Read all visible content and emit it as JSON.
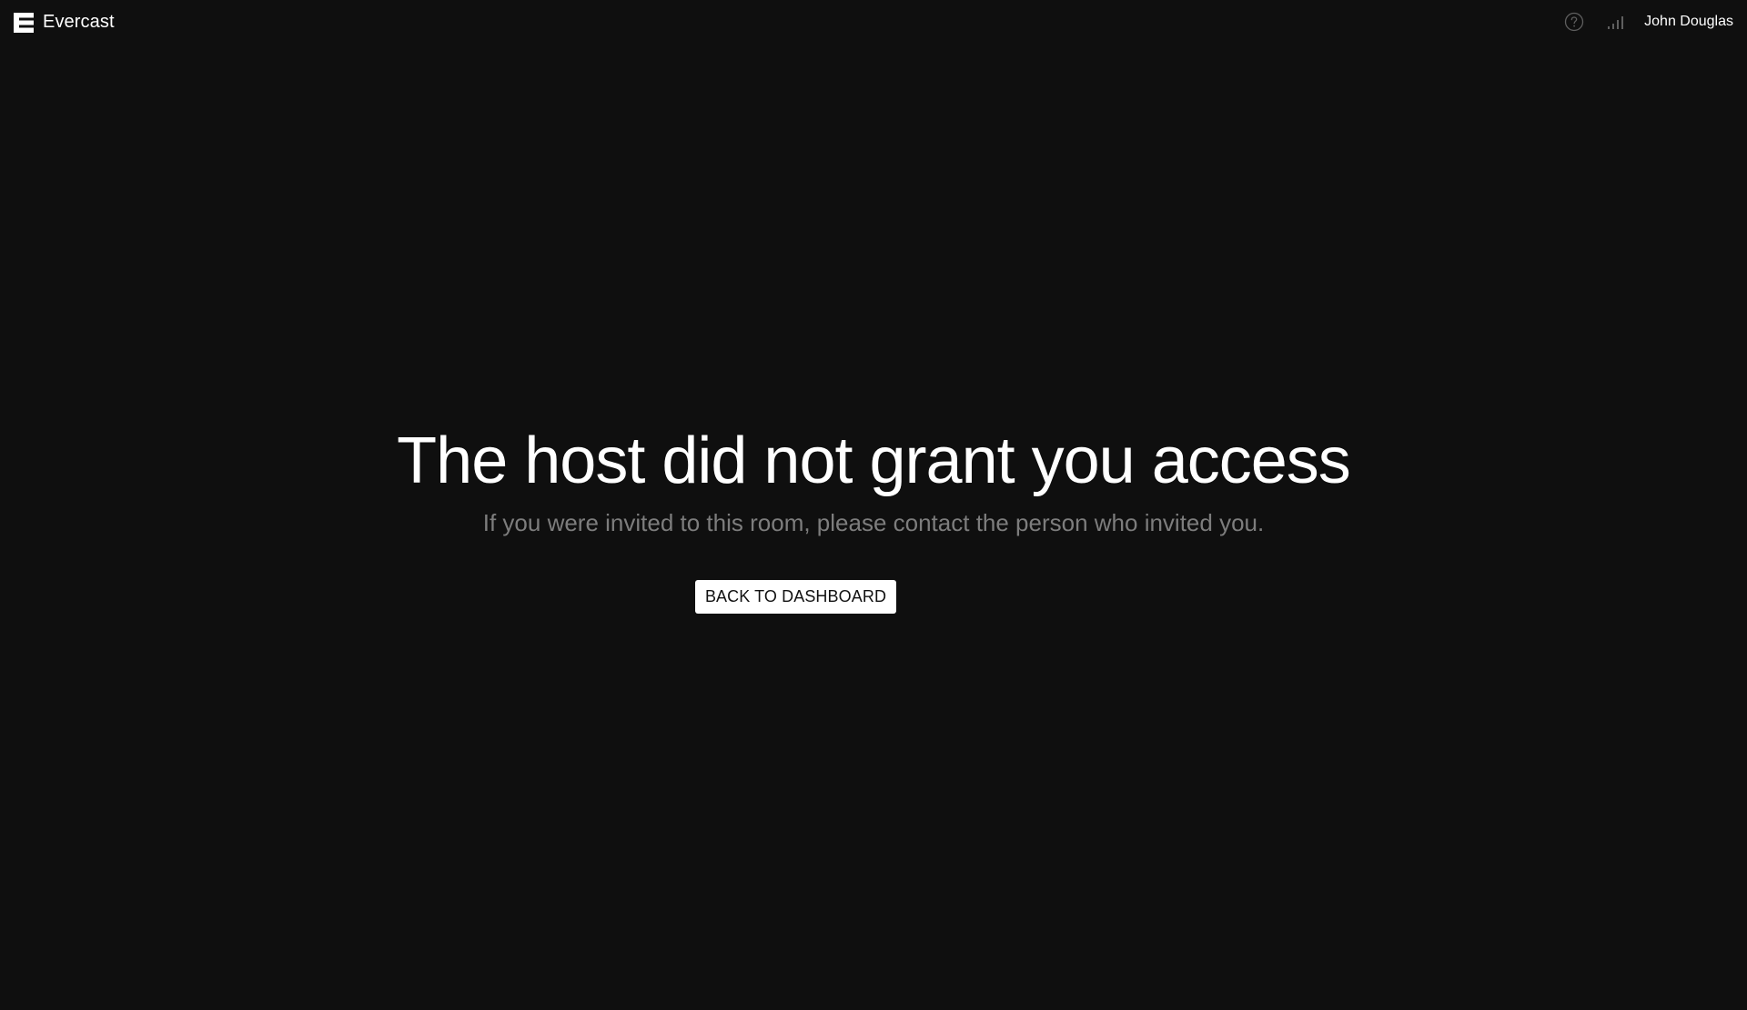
{
  "header": {
    "brand_name": "Evercast",
    "user_name": "John Douglas",
    "icons": {
      "logo": "evercast-logo-icon",
      "help": "help-circle-icon",
      "signal": "signal-strength-icon"
    }
  },
  "main": {
    "title": "The host did not grant you access",
    "subtitle": "If you were invited to this room, please contact the person who invited you.",
    "back_button_label": "BACK TO DASHBOARD"
  },
  "colors": {
    "background": "#0f0f0f",
    "text": "#ffffff",
    "muted_text": "#7d7d7d",
    "button_bg": "#ffffff",
    "button_text": "#111111"
  }
}
